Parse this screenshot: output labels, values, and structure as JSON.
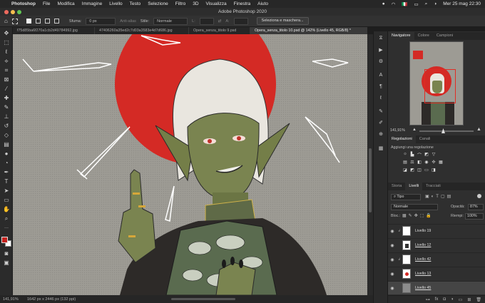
{
  "menubar": {
    "apple": "",
    "app": "Photoshop",
    "items": [
      "File",
      "Modifica",
      "Immagine",
      "Livello",
      "Testo",
      "Selezione",
      "Filtro",
      "3D",
      "Visualizza",
      "Finestra",
      "Aiuto"
    ],
    "flag": "🇮🇹",
    "datetime": "Mer 25 mag  22:30"
  },
  "window": {
    "title": "Adobe Photoshop 2020"
  },
  "options": {
    "sfuma_label": "Sfuma:",
    "sfuma_value": "0 px",
    "antialias": "Anti-alias",
    "stile_label": "Stile:",
    "stile_value": "Normale",
    "l_label": "L:",
    "a_label": "A:",
    "select_mask": "Seleziona e maschera..."
  },
  "tabs": [
    "f75d85ba6f270a1cb2d49784992.jpg",
    "47406260a35ed2c7d03a3583e4d7d686.jpg",
    "Opera_senza_titolo 9.psd",
    "Opera_senza_titolo 10.psd @ 142% (Livello 45, RGB/8) *"
  ],
  "status": {
    "zoom": "141,91%",
    "doc": "1642 px x 2446 px (132 ppi)"
  },
  "navigator": {
    "tabs": [
      "Navigatore",
      "Colore",
      "Campioni"
    ],
    "zoom": "141,91%"
  },
  "adjustments": {
    "tabs": [
      "Regolazioni",
      "Canali"
    ],
    "hint": "Aggiungi una regolazione"
  },
  "layers": {
    "tabs": [
      "Storia",
      "Livelli",
      "Tracciati"
    ],
    "filter": "Tipo",
    "blend": "Normale",
    "opacity_label": "Opacità:",
    "opacity": "87%",
    "lock_label": "Bloc.:",
    "fill_label": "Riempi:",
    "fill": "100%",
    "items": [
      {
        "name": "Livello 19",
        "underline": false
      },
      {
        "name": "Livello 12",
        "underline": true
      },
      {
        "name": "Livello 42",
        "underline": true
      },
      {
        "name": "Livello 13",
        "underline": true
      },
      {
        "name": "Livello 45",
        "underline": true
      }
    ]
  },
  "colors": {
    "fg": "#c4221e",
    "bg": "#ffffff",
    "sun": "#d42a25"
  }
}
